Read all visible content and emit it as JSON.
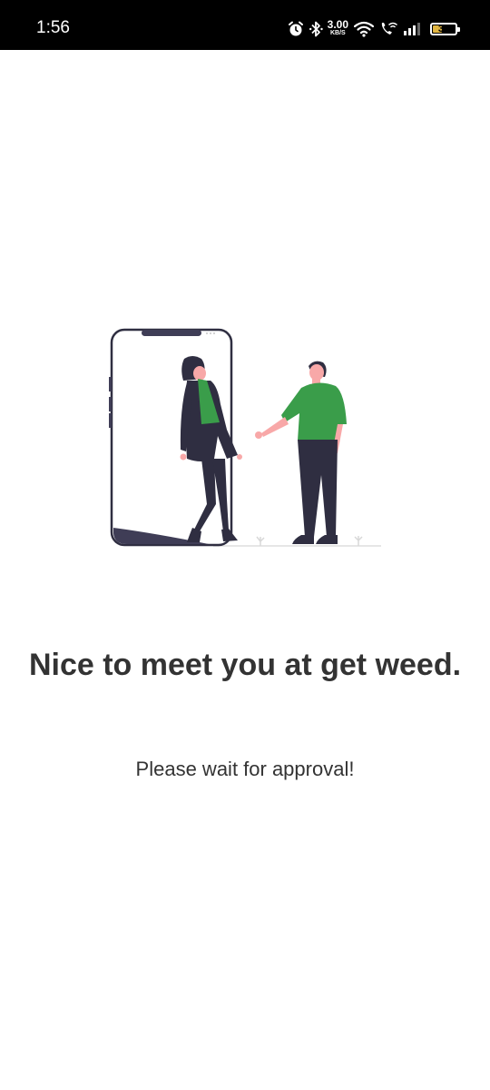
{
  "status_bar": {
    "time": "1:56",
    "network_speed_value": "3.00",
    "network_speed_unit": "KB/S",
    "battery_level": "39",
    "battery_fraction": 0.39,
    "icons": [
      "alarm-icon",
      "bluetooth-icon",
      "wifi-icon",
      "wifi-calling-icon",
      "signal-icon",
      "battery-icon"
    ]
  },
  "illustration": {
    "description_icon": "meet-illustration",
    "accent_color": "#3a9d4a",
    "dark_color": "#2f2e41",
    "skin_color": "#f8a8a8"
  },
  "welcome": {
    "title": "Nice to meet you at get weed.",
    "subtitle": "Please wait for approval!"
  }
}
